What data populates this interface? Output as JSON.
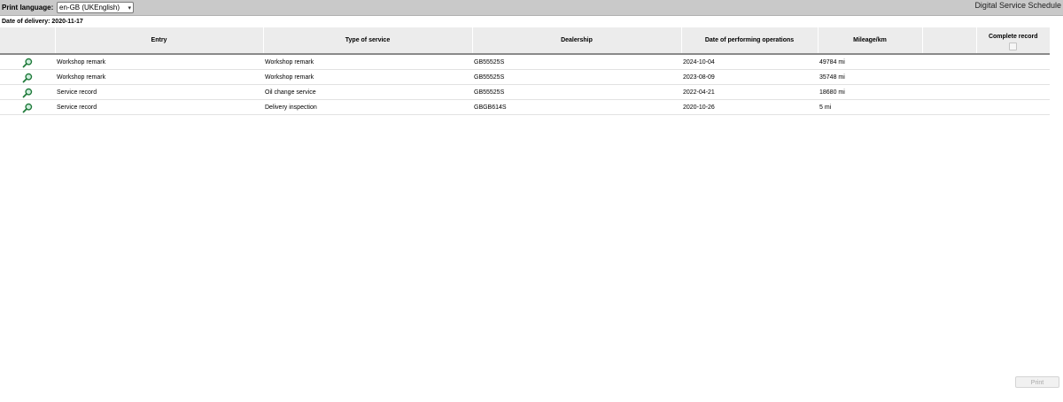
{
  "header": {
    "print_language_label": "Print language:",
    "language_selected": "en-GB (UKEnglish)",
    "app_title": "Digital Service Schedule"
  },
  "delivery": {
    "text": "Date of delivery: 2020-11-17"
  },
  "table": {
    "columns": {
      "entry": "Entry",
      "type_of_service": "Type of service",
      "dealership": "Dealership",
      "date": "Date of performing operations",
      "mileage": "Mileage/km",
      "complete_record": "Complete record"
    },
    "rows": [
      {
        "entry": "Workshop remark",
        "type": "Workshop remark",
        "dealership": "GB55525S",
        "date": "2024-10-04",
        "mileage": "49784 mi"
      },
      {
        "entry": "Workshop remark",
        "type": "Workshop remark",
        "dealership": "GB55525S",
        "date": "2023-08-09",
        "mileage": "35748 mi"
      },
      {
        "entry": "Service record",
        "type": "Oil change service",
        "dealership": "GB55525S",
        "date": "2022-04-21",
        "mileage": "18680 mi"
      },
      {
        "entry": "Service record",
        "type": "Delivery inspection",
        "dealership": "GBGB614S",
        "date": "2020-10-26",
        "mileage": "5 mi"
      }
    ]
  },
  "footer": {
    "print_label": "Print"
  },
  "icons": {
    "row_detail": "magnifier-icon",
    "language_dropdown": "chevron-down-icon"
  },
  "colors": {
    "topbar": "#c9c9c9",
    "magnifier": "#1f7a3a"
  }
}
